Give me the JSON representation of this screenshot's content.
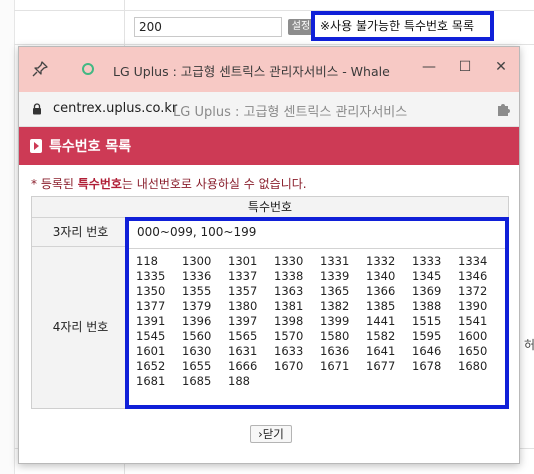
{
  "background": {
    "input_value": "200",
    "set_button_label": "설정",
    "special_numbers_link": "※사용 불가능한 특수번호 목록",
    "right_text": "허"
  },
  "window": {
    "title": "LG Uplus : 고급형 센트릭스 관리자서비스 - Whale",
    "address_host": "centrex.uplus.co.kr",
    "address_title": "LG Uplus : 고급형 센트릭스 관리자서비스",
    "controls": {
      "minimize": "—",
      "maximize": "☐",
      "close": "✕"
    }
  },
  "dialog": {
    "title": "특수번호 목록",
    "notice_prefix": "* 등록된 ",
    "notice_bold": "특수번호",
    "notice_suffix": "는 내선번호로 사용하실 수 없습니다.",
    "table_header": "특수번호",
    "row3_label": "3자리 번호",
    "row3_value": "000~099, 100~199",
    "row4_label": "4자리 번호",
    "row4_values": [
      "118",
      "1300",
      "1301",
      "1330",
      "1331",
      "1332",
      "1333",
      "1334",
      "1335",
      "1336",
      "1337",
      "1338",
      "1339",
      "1340",
      "1345",
      "1346",
      "1350",
      "1355",
      "1357",
      "1363",
      "1365",
      "1366",
      "1369",
      "1372",
      "1377",
      "1379",
      "1380",
      "1381",
      "1382",
      "1385",
      "1388",
      "1390",
      "1391",
      "1396",
      "1397",
      "1398",
      "1399",
      "1441",
      "1515",
      "1541",
      "1545",
      "1560",
      "1565",
      "1570",
      "1580",
      "1582",
      "1595",
      "1600",
      "1601",
      "1630",
      "1631",
      "1633",
      "1636",
      "1641",
      "1646",
      "1650",
      "1652",
      "1655",
      "1666",
      "1670",
      "1671",
      "1677",
      "1678",
      "1680",
      "1681",
      "1685",
      "188"
    ],
    "close_button": "›닫기"
  },
  "colors": {
    "header_band": "#cd3a55",
    "titlebar": "#f7c9c5",
    "highlight": "#1020d8"
  }
}
